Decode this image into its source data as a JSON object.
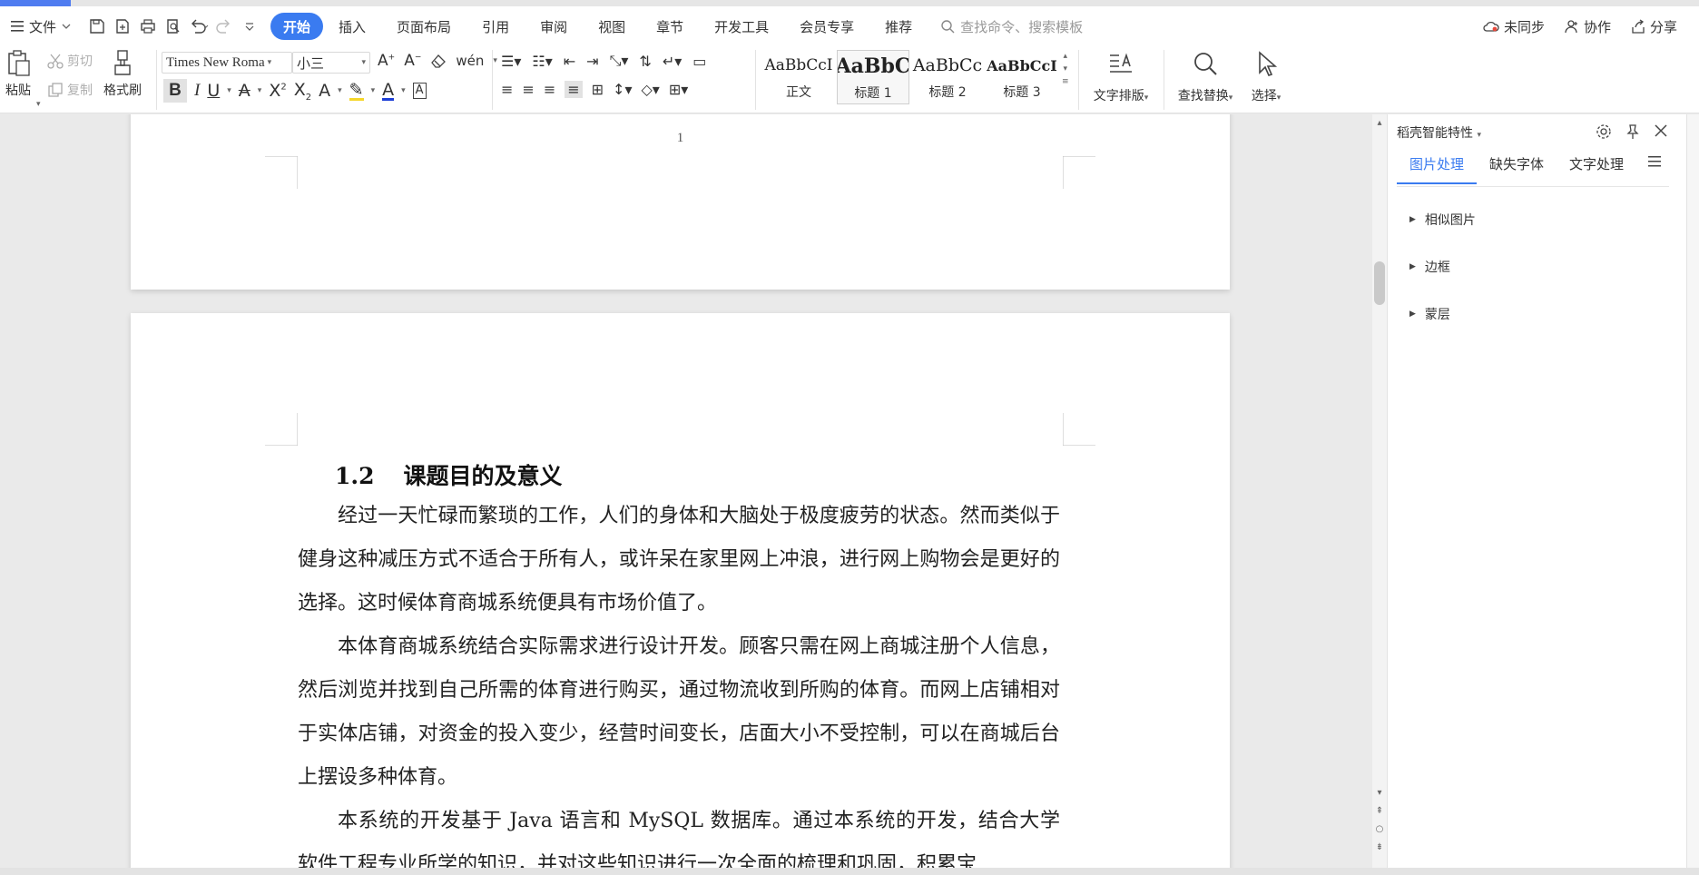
{
  "menu": {
    "file_label": "文件",
    "tabs": [
      "开始",
      "插入",
      "页面布局",
      "引用",
      "审阅",
      "视图",
      "章节",
      "开发工具",
      "会员专享",
      "推荐"
    ],
    "search_placeholder": "查找命令、搜索模板",
    "sync_label": "未同步",
    "collab_label": "协作",
    "share_label": "分享"
  },
  "ribbon": {
    "paste": "粘贴",
    "cut": "剪切",
    "copy": "复制",
    "format_painter": "格式刷",
    "font_name": "Times New Roma",
    "font_size": "小三",
    "styles": [
      {
        "sample": "AaBbCcI",
        "name": "正文"
      },
      {
        "sample": "AaBbC",
        "name": "标题 1"
      },
      {
        "sample": "AaBbCc",
        "name": "标题 2"
      },
      {
        "sample": "AaBbCcI",
        "name": "标题 3"
      }
    ],
    "text_layout": "文字排版",
    "find_replace": "查找替换",
    "select": "选择"
  },
  "document": {
    "page_number": "1",
    "heading_number": "1.2",
    "heading_text": "课题目的及意义",
    "paragraphs": [
      "经过一天忙碌而繁琐的工作，人们的身体和大脑处于极度疲劳的状态。然而类似于健身这种减压方式不适合于所有人，或许呆在家里网上冲浪，进行网上购物会是更好的选择。这时候体育商城系统便具有市场价值了。",
      "本体育商城系统结合实际需求进行设计开发。顾客只需在网上商城注册个人信息，然后浏览并找到自己所需的体育进行购买，通过物流收到所购的体育。而网上店铺相对于实体店铺，对资金的投入变少，经营时间变长，店面大小不受控制，可以在商城后台上摆设多种体育。",
      "本系统的开发基于 Java 语言和 MySQL 数据库。通过本系统的开发，结合大学软件工程专业所学的知识，并对这些知识进行一次全面的梳理和巩固，积累宝"
    ]
  },
  "panel": {
    "title": "稻壳智能特性",
    "tabs": [
      "图片处理",
      "缺失字体",
      "文字处理"
    ],
    "sections": [
      "相似图片",
      "边框",
      "蒙层"
    ]
  },
  "colors": {
    "accent": "#3a7bf0",
    "progress": "#4f7cf0"
  }
}
